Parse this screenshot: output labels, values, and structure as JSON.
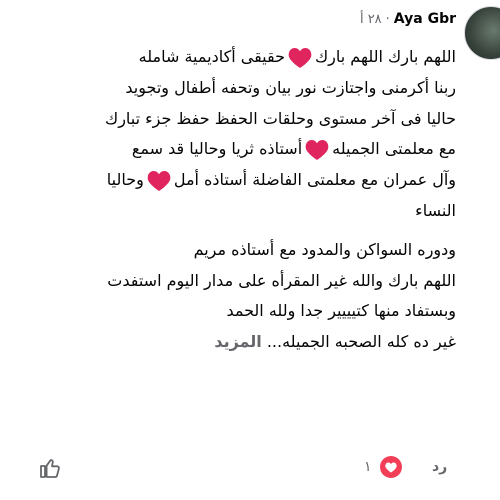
{
  "comment": {
    "author": "Aya Gbr",
    "time": "٢٨ أ",
    "separator": "·",
    "lines": [
      [
        "اللهم بارك اللهم بارك",
        "heart",
        "حقيقى أكاديمية شامله"
      ],
      [
        "ربنا أكرمنى واجتازت نور بيان وتحفه أطفال وتجويد"
      ],
      [
        "حاليا فى آخر مستوى وحلقات الحفظ حفظ جزء تبارك"
      ],
      [
        "مع معلمتى الجميله",
        "heart",
        "أستاذه ثريا وحاليا قد سمع"
      ],
      [
        "وآل عمران مع معلمتى الفاضلة أستاذه أمل",
        "heart",
        "وحاليا"
      ],
      [
        "النساء"
      ],
      [
        "ودوره السواكن والمدود مع أستاذه مريم"
      ],
      [
        "اللهم بارك والله غير المقرأه على مدار اليوم استفدت"
      ],
      [
        "وبستفاد منها كتيييير جدا ولله الحمد"
      ]
    ],
    "last_line": "غير ده كله الصحبه الجميله...",
    "see_more": "المزيد"
  },
  "actions": {
    "reply_label": "رد",
    "reaction_count": "١",
    "like_icon": "thumbs-up-icon",
    "reaction_icon": "heart-reaction-icon"
  },
  "colors": {
    "heart": "#e0245e",
    "muted": "#65676b",
    "reaction_bg": "#f33e58"
  }
}
